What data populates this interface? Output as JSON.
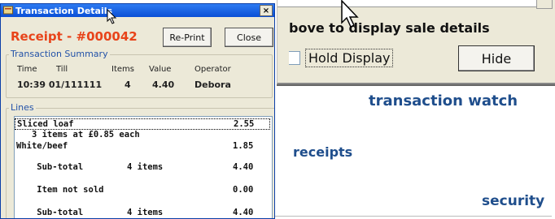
{
  "background_window": {
    "message": "bove to display sale details",
    "hold_display_label": "Hold Display",
    "hide_button": "Hide"
  },
  "headlines": {
    "transaction_watch": "transaction watch",
    "receipts": "receipts",
    "security": "security"
  },
  "dialog": {
    "title": "Transaction Details",
    "close_glyph": "×",
    "receipt_label": "Receipt - #000042",
    "reprint_button": "Re-Print",
    "close_button": "Close",
    "summary": {
      "title": "Transaction Summary",
      "headers": [
        "Time",
        "Till",
        "Items",
        "Value",
        "Operator"
      ],
      "values": [
        "10:39 01/111111",
        "4",
        "4.40",
        "Debora"
      ]
    },
    "lines": {
      "title": "Lines",
      "rows": [
        {
          "text": "Sliced loaf",
          "mid": "",
          "amount": "2.55"
        },
        {
          "text": "   3 items at £0.85 each",
          "mid": "",
          "amount": ""
        },
        {
          "text": "White/beef",
          "mid": "",
          "amount": "1.85"
        },
        {
          "text": "    Sub-total",
          "mid": "4 items",
          "amount": "4.40"
        },
        {
          "text": "    Item not sold",
          "mid": "",
          "amount": "0.00"
        },
        {
          "text": "    Sub-total",
          "mid": "4 items",
          "amount": "4.40"
        }
      ]
    }
  },
  "colors": {
    "accent_red": "#e8441a",
    "headline_blue": "#1f4e8c",
    "title_blue": "#0a4fd6"
  }
}
